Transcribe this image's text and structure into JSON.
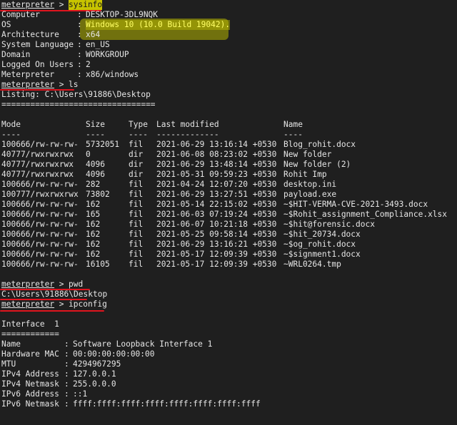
{
  "sysinfo": {
    "prompt": "meterpreter",
    "sep": " > ",
    "command": "sysinfo",
    "rows": [
      {
        "key": "Computer",
        "value": "DESKTOP-3DL9NQK"
      },
      {
        "key": "OS",
        "value": "Windows 10 (10.0 Build 19042)."
      },
      {
        "key": "Architecture",
        "value": "x64"
      },
      {
        "key": "System Language",
        "value": "en_US"
      },
      {
        "key": "Domain",
        "value": "WORKGROUP"
      },
      {
        "key": "Logged On Users",
        "value": "2"
      },
      {
        "key": "Meterpreter",
        "value": "x86/windows"
      }
    ]
  },
  "ls": {
    "prompt": "meterpreter",
    "sep": " > ",
    "command": "ls",
    "listing": "Listing: C:\\Users\\91886\\Desktop",
    "rule": "================================",
    "headers": [
      "Mode",
      "Size",
      "Type",
      "Last modified",
      "Name"
    ],
    "dashes": [
      "----",
      "----",
      "----",
      "-------------",
      "----"
    ],
    "rows": [
      {
        "mode": "100666/rw-rw-rw-",
        "size": "5732051",
        "type": "fil",
        "modified": "2021-06-29 13:16:14 +0530",
        "name": "Blog_rohit.docx"
      },
      {
        "mode": "40777/rwxrwxrwx",
        "size": "0",
        "type": "dir",
        "modified": "2021-06-08 08:23:02 +0530",
        "name": "New folder"
      },
      {
        "mode": "40777/rwxrwxrwx",
        "size": "4096",
        "type": "dir",
        "modified": "2021-06-29 13:48:14 +0530",
        "name": "New folder (2)"
      },
      {
        "mode": "40777/rwxrwxrwx",
        "size": "4096",
        "type": "dir",
        "modified": "2021-05-31 09:59:23 +0530",
        "name": "Rohit Imp"
      },
      {
        "mode": "100666/rw-rw-rw-",
        "size": "282",
        "type": "fil",
        "modified": "2021-04-24 12:07:20 +0530",
        "name": "desktop.ini"
      },
      {
        "mode": "100777/rwxrwxrwx",
        "size": "73802",
        "type": "fil",
        "modified": "2021-06-29 13:27:51 +0530",
        "name": "payload.exe"
      },
      {
        "mode": "100666/rw-rw-rw-",
        "size": "162",
        "type": "fil",
        "modified": "2021-05-14 22:15:02 +0530",
        "name": "~$HIT-VERMA-CVE-2021-3493.docx"
      },
      {
        "mode": "100666/rw-rw-rw-",
        "size": "165",
        "type": "fil",
        "modified": "2021-06-03 07:19:24 +0530",
        "name": "~$Rohit_assignment_Compliance.xlsx"
      },
      {
        "mode": "100666/rw-rw-rw-",
        "size": "162",
        "type": "fil",
        "modified": "2021-06-07 10:21:18 +0530",
        "name": "~$hit@forensic.docx"
      },
      {
        "mode": "100666/rw-rw-rw-",
        "size": "162",
        "type": "fil",
        "modified": "2021-05-25 09:58:14 +0530",
        "name": "~$hit_20734.docx"
      },
      {
        "mode": "100666/rw-rw-rw-",
        "size": "162",
        "type": "fil",
        "modified": "2021-06-29 13:16:21 +0530",
        "name": "~$og_rohit.docx"
      },
      {
        "mode": "100666/rw-rw-rw-",
        "size": "162",
        "type": "fil",
        "modified": "2021-05-17 12:09:39 +0530",
        "name": "~$signment1.docx"
      },
      {
        "mode": "100666/rw-rw-rw-",
        "size": "16105",
        "type": "fil",
        "modified": "2021-05-17 12:09:39 +0530",
        "name": "~WRL0264.tmp"
      }
    ]
  },
  "pwd": {
    "prompt": "meterpreter",
    "sep": " > ",
    "command": "pwd",
    "output": "C:\\Users\\91886\\Desktop"
  },
  "ipconfig": {
    "prompt": "meterpreter",
    "sep": " > ",
    "command": "ipconfig",
    "interface_title": "Interface  1",
    "rule": "============",
    "rows": [
      {
        "key": "Name",
        "value": "Software Loopback Interface 1"
      },
      {
        "key": "Hardware MAC",
        "value": "00:00:00:00:00:00"
      },
      {
        "key": "MTU",
        "value": "4294967295"
      },
      {
        "key": "IPv4 Address",
        "value": "127.0.0.1"
      },
      {
        "key": "IPv4 Netmask",
        "value": "255.0.0.0"
      },
      {
        "key": "IPv6 Address",
        "value": "::1"
      },
      {
        "key": "IPv6 Netmask",
        "value": "ffff:ffff:ffff:ffff:ffff:ffff:ffff:ffff"
      }
    ]
  },
  "colors": {
    "background": "#1f1f1f",
    "text": "#e6e6e6",
    "underline_annotation": "#e0141e",
    "highlight": "#c8c400"
  }
}
